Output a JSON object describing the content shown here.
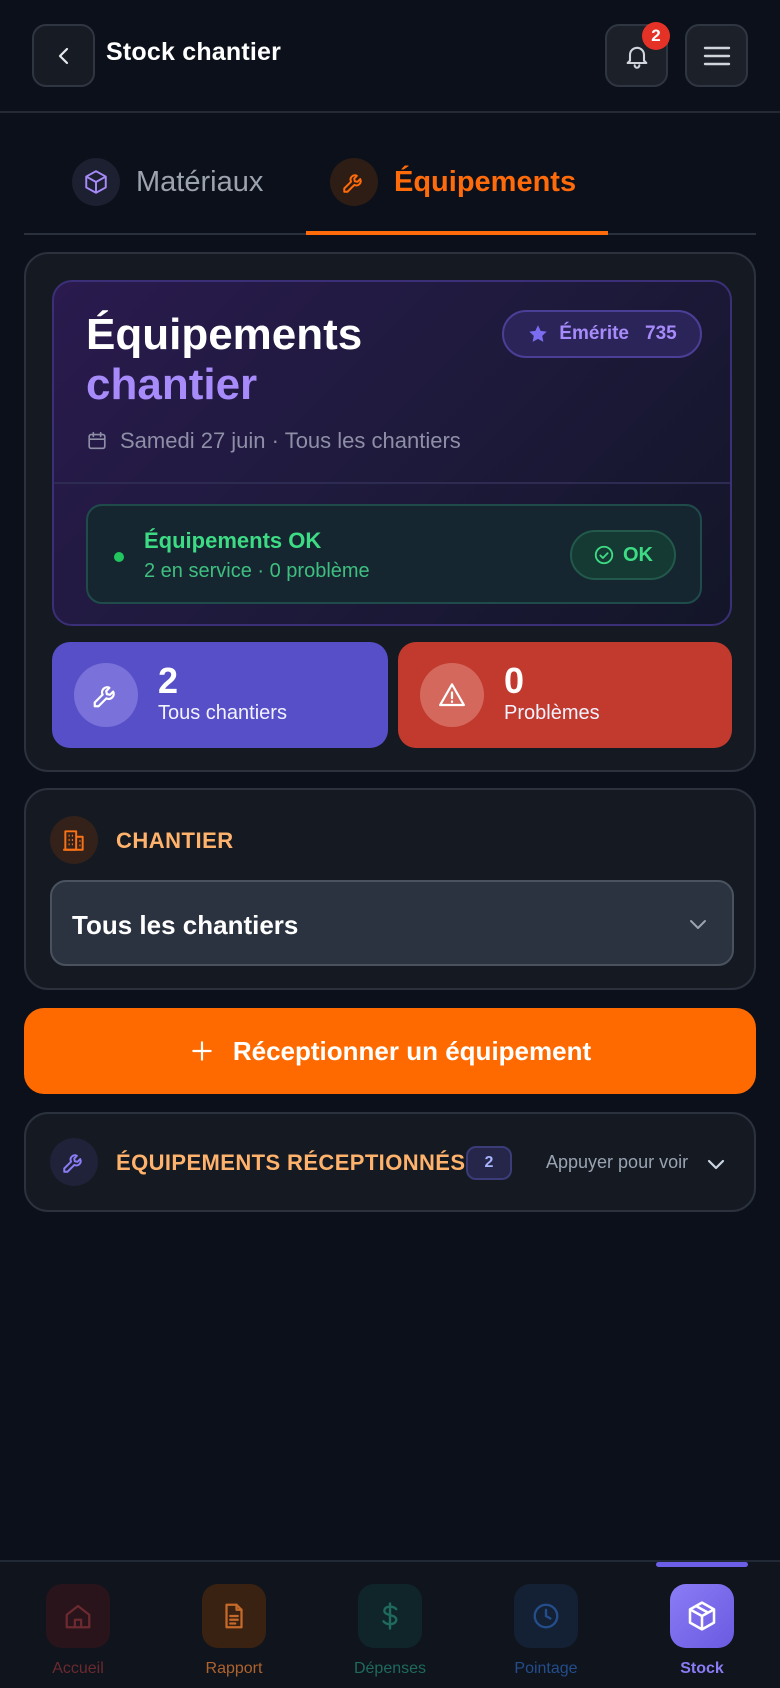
{
  "header": {
    "title": "Stock chantier",
    "notification_count": "2"
  },
  "tabs": [
    {
      "label": "Matériaux",
      "active": false
    },
    {
      "label": "Équipements",
      "active": true
    }
  ],
  "hero": {
    "title_line1": "Équipements",
    "title_line2": "chantier",
    "badge_label": "Émérite",
    "badge_score": "735",
    "date_text": "Samedi 27 juin · Tous les chantiers",
    "status": {
      "title": "Équipements OK",
      "subtitle": "2 en service · 0 problème",
      "pill_label": "OK"
    }
  },
  "stats": [
    {
      "value": "2",
      "label": "Tous chantiers"
    },
    {
      "value": "0",
      "label": "Problèmes"
    }
  ],
  "chantier": {
    "label": "CHANTIER",
    "selected": "Tous les chantiers"
  },
  "cta": {
    "label": "Réceptionner un équipement"
  },
  "received": {
    "label": "ÉQUIPEMENTS RÉCEPTIONNÉS",
    "count": "2",
    "hint": "Appuyer pour voir"
  },
  "bottom_nav": [
    {
      "label": "Accueil",
      "icon": "home-icon"
    },
    {
      "label": "Rapport",
      "icon": "document-icon"
    },
    {
      "label": "Dépenses",
      "icon": "dollar-icon"
    },
    {
      "label": "Pointage",
      "icon": "clock-icon"
    },
    {
      "label": "Stock",
      "icon": "package-icon",
      "active": true
    }
  ],
  "colors": {
    "accent_orange": "#ff6a00",
    "accent_purple": "#a78bfa",
    "status_green": "#3ddc84",
    "danger_red": "#c23a2d",
    "stat_purple": "#574fc7"
  }
}
